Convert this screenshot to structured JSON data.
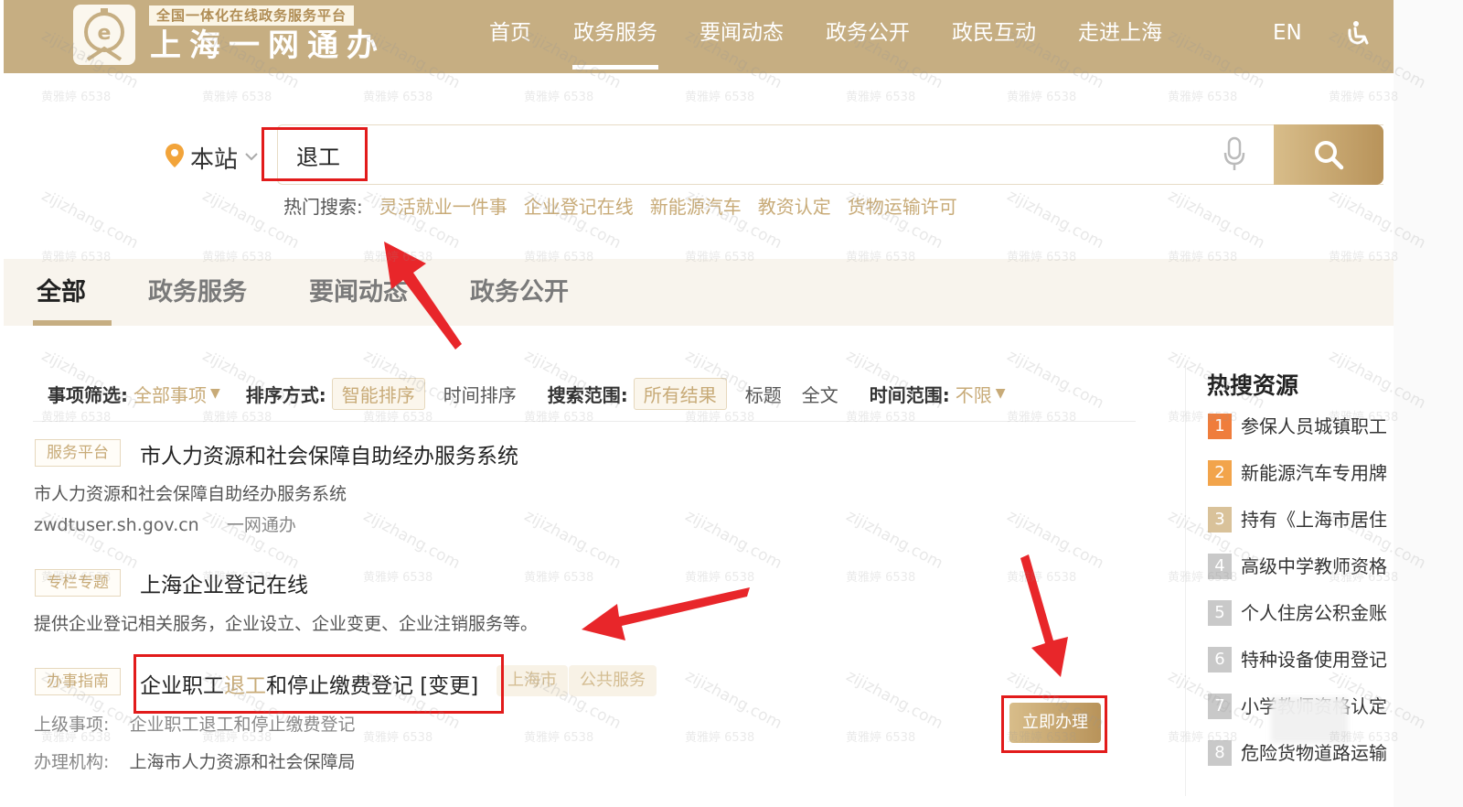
{
  "header": {
    "brand_tag": "全国一体化在线政务服务平台",
    "brand_name": "上海一网通办",
    "nav": [
      "首页",
      "政务服务",
      "要闻动态",
      "政务公开",
      "政民互动",
      "走进上海"
    ],
    "active_nav": "政务服务",
    "lang": "EN",
    "accessibility_icon": "accessibility-icon"
  },
  "search": {
    "scope": "本站",
    "query": "退工",
    "hot_label": "热门搜索:",
    "hot_terms": [
      "灵活就业一件事",
      "企业登记在线",
      "新能源汽车",
      "教资认定",
      "货物运输许可"
    ]
  },
  "tabs": [
    "全部",
    "政务服务",
    "要闻动态",
    "政务公开"
  ],
  "active_tab": "全部",
  "filters": {
    "item_label": "事项筛选:",
    "item_value": "全部事项",
    "sort_label": "排序方式:",
    "sort_options": [
      "智能排序",
      "时间排序"
    ],
    "sort_selected": "智能排序",
    "range_label": "搜索范围:",
    "range_options": [
      "所有结果",
      "标题",
      "全文"
    ],
    "range_selected": "所有结果",
    "time_label": "时间范围:",
    "time_value": "不限"
  },
  "results": [
    {
      "tag": "服务平台",
      "title": "市人力资源和社会保障自助经办服务系统",
      "desc": "市人力资源和社会保障自助经办服务系统",
      "url": "zwdtuser.sh.gov.cn",
      "source": "一网通办"
    },
    {
      "tag": "专栏专题",
      "title": "上海企业登记在线",
      "desc": "提供企业登记相关服务，企业设立、企业变更、企业注销服务等。"
    },
    {
      "tag": "办事指南",
      "title_before": "企业职工",
      "title_highlight": "退工",
      "title_after": "和停止缴费登记 [变更]",
      "badges": [
        "上海市",
        "公共服务"
      ],
      "parent_label": "上级事项:",
      "parent_value": "企业职工退工和停止缴费登记",
      "agency_label": "办理机构:",
      "agency_value": "上海市人力资源和社会保障局",
      "action": "立即办理"
    }
  ],
  "hot_resources": {
    "title": "热搜资源",
    "items": [
      {
        "rank": "1",
        "text": "参保人员城镇职工"
      },
      {
        "rank": "2",
        "text": "新能源汽车专用牌"
      },
      {
        "rank": "3",
        "text": "持有《上海市居住"
      },
      {
        "rank": "4",
        "text": "高级中学教师资格"
      },
      {
        "rank": "5",
        "text": "个人住房公积金账"
      },
      {
        "rank": "6",
        "text": "特种设备使用登记"
      },
      {
        "rank": "7",
        "text": "小学教师资格认定"
      },
      {
        "rank": "8",
        "text": "危险货物道路运输"
      }
    ]
  },
  "watermark": {
    "text": "zijizhang.com",
    "text_cn": "黄雅婷 6538"
  },
  "colors": {
    "brand": "#c6ae82",
    "accent_text": "#c8ab78",
    "annotation_red": "#e21b1b"
  }
}
